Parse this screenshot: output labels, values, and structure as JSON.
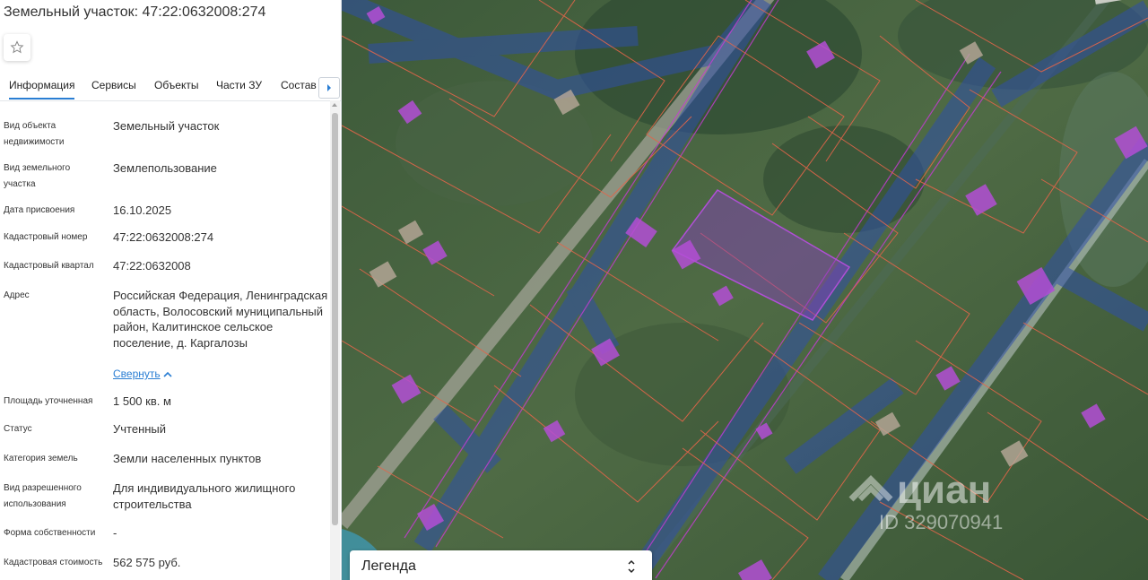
{
  "panel": {
    "title": "Земельный участок: 47:22:0632008:274",
    "tabs": [
      "Информация",
      "Сервисы",
      "Объекты",
      "Части ЗУ",
      "Состав"
    ],
    "collapse_label": "Свернуть",
    "rows": [
      {
        "label": "Вид объекта недвижимости",
        "value": "Земельный участок"
      },
      {
        "label": "Вид земельного участка",
        "value": "Землепользование"
      },
      {
        "label": "Дата присвоения",
        "value": "16.10.2025"
      },
      {
        "label": "Кадастровый номер",
        "value": "47:22:0632008:274"
      },
      {
        "label": "Кадастровый квартал",
        "value": "47:22:0632008"
      },
      {
        "label": "Адрес",
        "value": "Российская Федерация, Ленинградская область, Волосовский муниципальный район, Калитинское сельское поселение, д. Каргалозы"
      },
      {
        "label": "Площадь уточненная",
        "value": "1 500 кв. м"
      },
      {
        "label": "Статус",
        "value": "Учтенный"
      },
      {
        "label": "Категория земель",
        "value": "Земли населенных пунктов"
      },
      {
        "label": "Вид разрешенного использования",
        "value": "Для индивидуального жилищного строительства"
      },
      {
        "label": "Форма собственности",
        "value": "-"
      },
      {
        "label": "Кадастровая стоимость",
        "value": "562 575 руб."
      }
    ]
  },
  "map": {
    "legend_label": "Легенда",
    "watermark_brand": "циан",
    "watermark_id": "ID 329070941"
  },
  "icons": [
    "star-icon",
    "chevron-right-icon",
    "chevron-up-icon",
    "expand-collapse-icon"
  ],
  "colors": {
    "accent": "#2a7ed3",
    "parcel_border": "#e2654a",
    "selected_parcel": "#8a3fc0",
    "building": "#b44fd6"
  }
}
